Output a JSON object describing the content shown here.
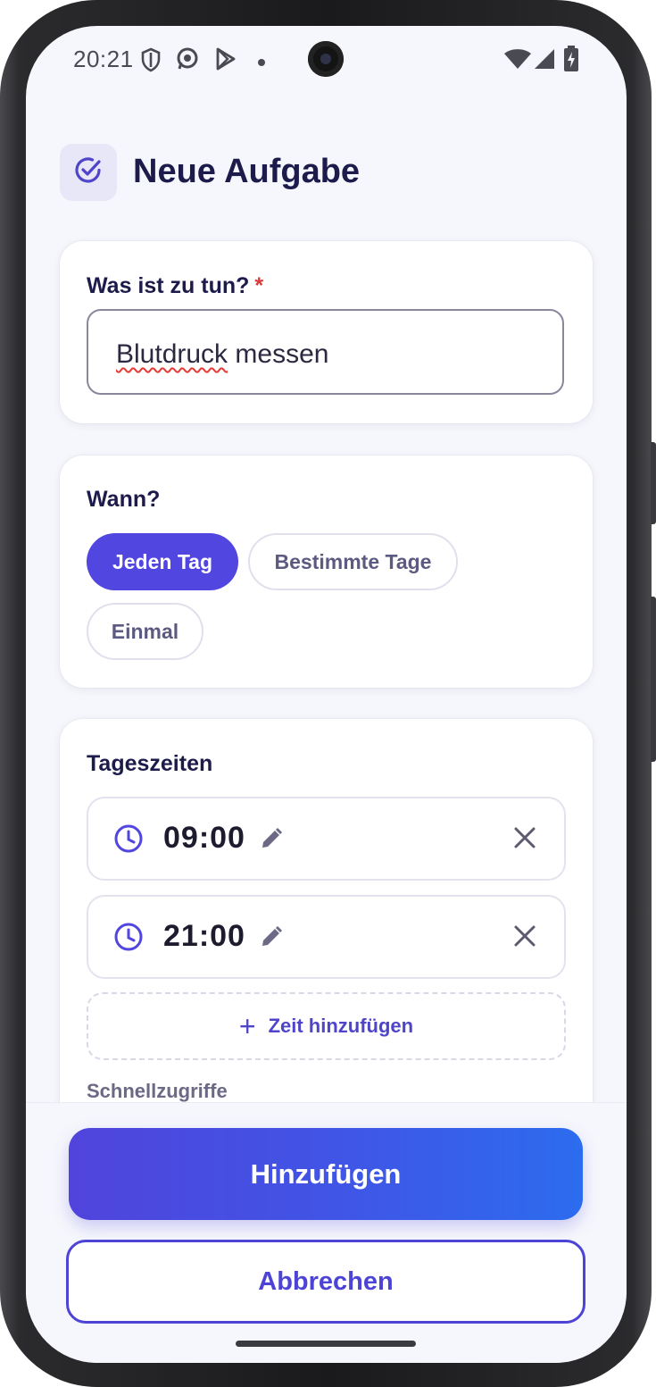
{
  "status_bar": {
    "time": "20:21",
    "icons": [
      "shield-icon",
      "whatsapp-icon",
      "play-store-icon",
      "dot-icon",
      "wifi-icon",
      "signal-icon",
      "battery-charging-icon"
    ]
  },
  "header": {
    "title": "Neue Aufgabe",
    "icon": "check-circle-icon"
  },
  "task_card": {
    "label": "Was ist zu tun?",
    "required_marker": "*",
    "input_value_misspelled": "Blutdruck",
    "input_value_rest": " messen"
  },
  "when_card": {
    "label": "Wann?",
    "options": [
      {
        "label": "Jeden Tag",
        "selected": true
      },
      {
        "label": "Bestimmte Tage",
        "selected": false
      },
      {
        "label": "Einmal",
        "selected": false
      }
    ]
  },
  "times_card": {
    "label": "Tageszeiten",
    "times": [
      "09:00",
      "21:00"
    ],
    "add_label": "Zeit hinzufügen",
    "quick_label": "Schnellzugriffe"
  },
  "actions": {
    "primary_label": "Hinzufügen",
    "secondary_label": "Abbrechen"
  },
  "colors": {
    "accent": "#5146e0",
    "accent_gradient_end": "#2c6cee",
    "title": "#1d1b4b",
    "required": "#d83a3a",
    "background": "#f6f7fc"
  }
}
